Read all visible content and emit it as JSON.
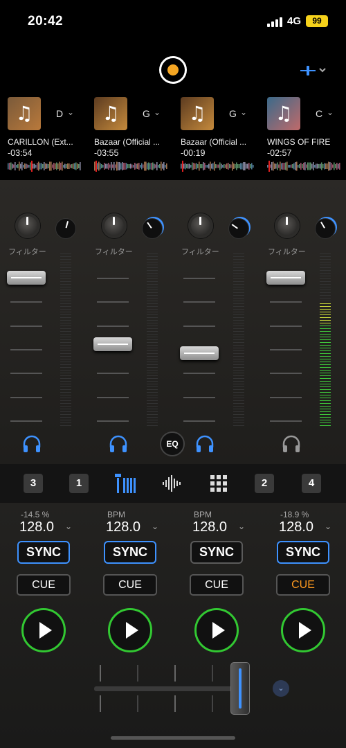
{
  "status": {
    "time": "20:42",
    "network": "4G",
    "battery": "99"
  },
  "decks": [
    {
      "key": "D",
      "title": "CARILLON (Ext...",
      "time": "-03:54",
      "art_colors": [
        "#7a5a3a",
        "#b9793b"
      ]
    },
    {
      "key": "G",
      "title": "Bazaar (Official ...",
      "time": "-03:55",
      "art_colors": [
        "#5c3b20",
        "#c58a3c"
      ]
    },
    {
      "key": "G",
      "title": "Bazaar (Official ...",
      "time": "-00:19",
      "art_colors": [
        "#5c3b20",
        "#c58a3c"
      ]
    },
    {
      "key": "C",
      "title": "WINGS OF FIRE",
      "time": "-02:57",
      "art_colors": [
        "#3b6a8a",
        "#c06a6a"
      ]
    }
  ],
  "mixer": {
    "filter_label": "フィルター",
    "eq_label": "EQ",
    "channels": [
      {
        "volume": 1.0,
        "headphones_active": true
      },
      {
        "volume": 0.53,
        "headphones_active": true
      },
      {
        "volume": 0.47,
        "headphones_active": true
      },
      {
        "volume": 1.0,
        "headphones_active": false
      }
    ],
    "meter_level_ch4": 0.73
  },
  "toolbar": {
    "buttons": [
      "3",
      "1",
      "mixer-icon",
      "waveform-icon",
      "pads-grid-icon",
      "2",
      "4"
    ]
  },
  "controls": [
    {
      "pitch": "-14.5 %",
      "bpm": "128.0",
      "sync": "SYNC",
      "sync_on": true,
      "cue": "CUE",
      "cue_orange": false
    },
    {
      "pitch": "BPM",
      "bpm": "128.0",
      "sync": "SYNC",
      "sync_on": true,
      "cue": "CUE",
      "cue_orange": false
    },
    {
      "pitch": "BPM",
      "bpm": "128.0",
      "sync": "SYNC",
      "sync_on": false,
      "cue": "CUE",
      "cue_orange": false
    },
    {
      "pitch": "-18.9 %",
      "bpm": "128.0",
      "sync": "SYNC",
      "sync_on": true,
      "cue": "CUE",
      "cue_orange": true
    }
  ],
  "crossfader": {
    "position": 0.95
  },
  "colors": {
    "accent_blue": "#3e92ff",
    "play_green": "#32c832",
    "cue_orange": "#ff9a1f",
    "record": "#f5a623"
  }
}
